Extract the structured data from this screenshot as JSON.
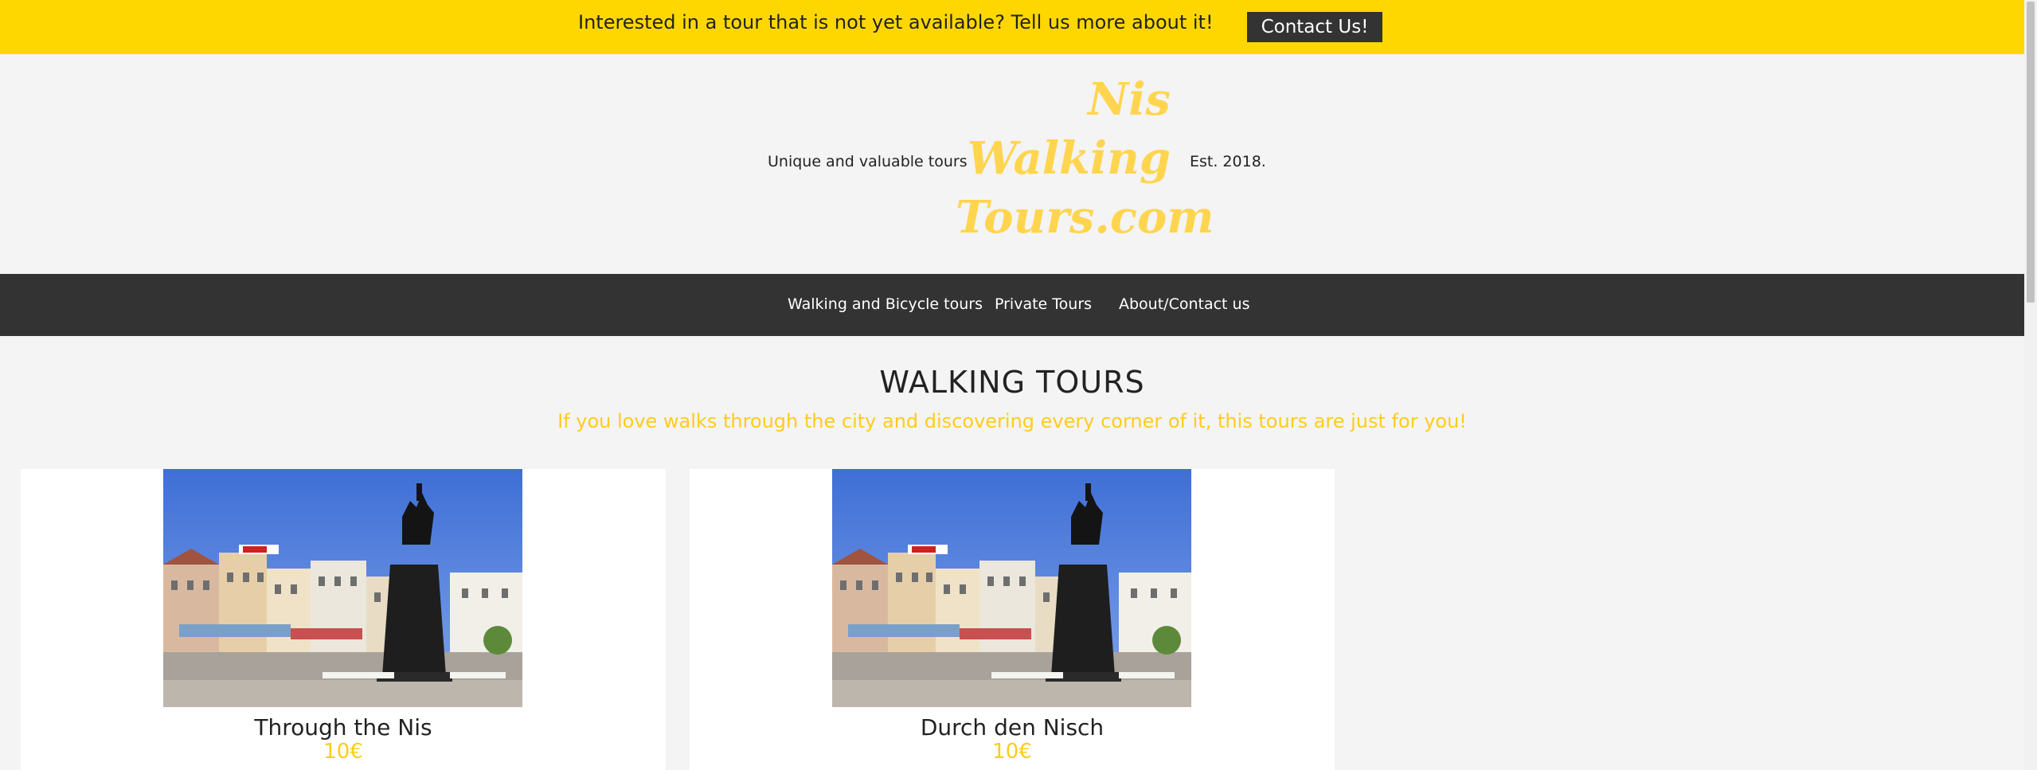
{
  "announcement": {
    "text": "Interested in a tour that is not yet available? Tell us more about it!",
    "button_label": "Contact Us!"
  },
  "header": {
    "tagline": "Unique and valuable tours",
    "logo_lines": [
      "Nis",
      "Walking",
      "Tours.com"
    ],
    "established": "Est. 2018."
  },
  "nav": {
    "items": [
      {
        "label": "Walking and Bicycle tours"
      },
      {
        "label": "Private Tours"
      },
      {
        "label": "About/Contact us"
      }
    ]
  },
  "section": {
    "title": "WALKING TOURS",
    "subtitle": "If you love walks through the city and discovering every corner of it, this tours are just for you!"
  },
  "tours": [
    {
      "title": "Through the Nis",
      "price": "10€"
    },
    {
      "title": "Durch den Nisch",
      "price": "10€"
    }
  ],
  "colors": {
    "accent_yellow": "#ffd700",
    "logo_yellow": "#ffd54f",
    "dark": "#333333",
    "background": "#f4f4f4"
  }
}
